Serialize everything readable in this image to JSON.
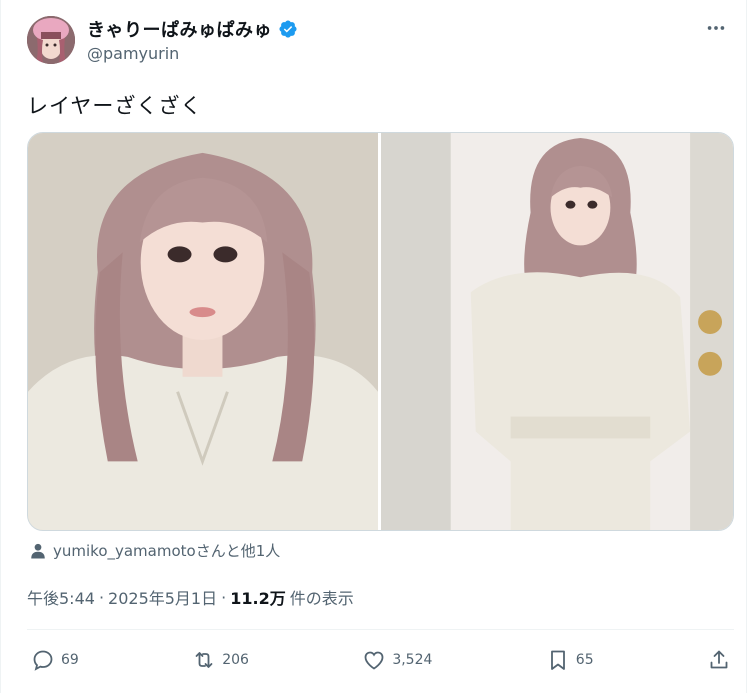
{
  "user": {
    "display_name": "きゃりーぱみゅぱみゅ",
    "handle": "@pamyurin",
    "verified_icon": "verified-badge-icon"
  },
  "tweet": {
    "text": "レイヤーざくざく"
  },
  "media": {
    "photo_count": 2
  },
  "tagged": {
    "text": "yumiko_yamamotoさんと他1人",
    "icon": "person-icon"
  },
  "meta": {
    "time": "午後5:44",
    "sep1": "·",
    "date": "2025年5月1日",
    "sep2": "·",
    "views_count": "11.2万",
    "views_label": "件の表示"
  },
  "actions": {
    "replies": "69",
    "retweets": "206",
    "likes": "3,524",
    "bookmarks": "65"
  },
  "colors": {
    "text": "#0f1419",
    "secondary": "#536471",
    "verified": "#1d9bf0",
    "border": "#eff3f4"
  }
}
